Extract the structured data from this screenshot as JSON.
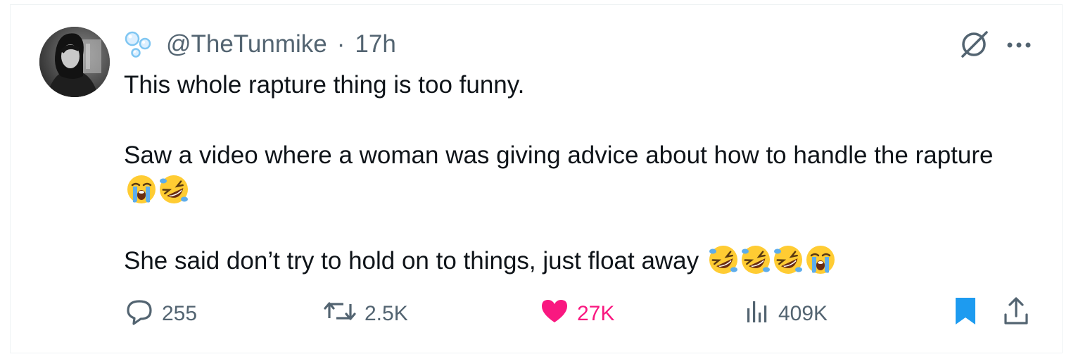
{
  "tweet": {
    "handle": "@TheTunmike",
    "separator": "·",
    "time": "17h",
    "paragraphs": [
      {
        "text": "This whole rapture thing is too funny.",
        "emojis": []
      },
      {
        "text": "Saw a video where a woman was giving advice about how to handle the rapture",
        "emojis": [
          "loudly-crying-face",
          "rolling-on-the-floor-laughing"
        ]
      },
      {
        "text": "She said don’t try to hold on to things, just float away",
        "emojis": [
          "rolling-on-the-floor-laughing",
          "rolling-on-the-floor-laughing",
          "rolling-on-the-floor-laughing",
          "loudly-crying-face"
        ]
      }
    ]
  },
  "actions": {
    "reply_count": "255",
    "repost_count": "2.5K",
    "like_count": "27K",
    "view_count": "409K"
  },
  "icons": {
    "reply": "speech-bubble-icon",
    "repost": "repost-arrows-icon",
    "like": "heart-icon",
    "views": "analytics-bars-icon",
    "bookmark": "bookmark-icon",
    "share": "share-icon",
    "grok": "grok-icon",
    "more": "more-dots-icon",
    "badge": "bubbles-icon"
  },
  "colors": {
    "text": "#0f1419",
    "secondary": "#536471",
    "like": "#f91880",
    "bookmark": "#1d9bf0",
    "badge": "#7fc6f2"
  }
}
